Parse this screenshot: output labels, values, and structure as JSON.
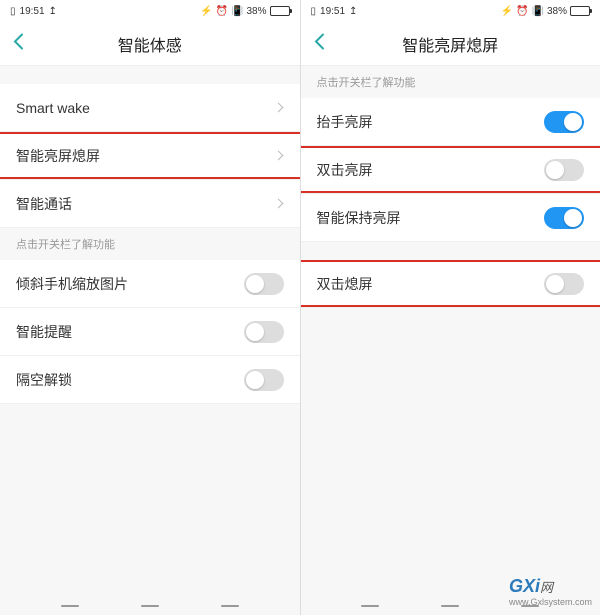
{
  "status": {
    "time": "19:51",
    "battery_percent": "38%"
  },
  "left": {
    "title": "智能体感",
    "rows": {
      "smart_wake": "Smart wake",
      "smart_screen": "智能亮屏熄屏",
      "smart_call": "智能通话"
    },
    "section_header": "点击开关栏了解功能",
    "toggles": {
      "tilt_zoom": "倾斜手机缩放图片",
      "smart_remind": "智能提醒",
      "air_unlock": "隔空解锁"
    }
  },
  "right": {
    "title": "智能亮屏熄屏",
    "section_header": "点击开关栏了解功能",
    "toggles": {
      "raise_wake": "抬手亮屏",
      "double_tap_wake": "双击亮屏",
      "smart_keep": "智能保持亮屏",
      "double_tap_sleep": "双击熄屏"
    }
  },
  "watermark": {
    "brand": "GXi",
    "suffix": "网",
    "url": "www.Gxlsystem.com"
  }
}
